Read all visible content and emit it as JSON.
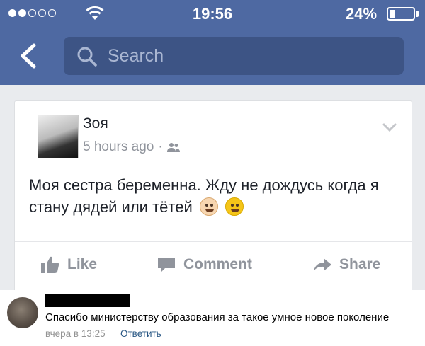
{
  "status_bar": {
    "time": "19:56",
    "battery": "24%",
    "battery_level": 0.24
  },
  "nav": {
    "search_placeholder": "Search"
  },
  "post": {
    "author": "Зоя",
    "time": "5 hours ago",
    "separator": "·",
    "text": "Моя сестра беременна. Жду не дождусь когда я стану дядей или тётей",
    "emojis": [
      "baby-emoji",
      "sweat-smile-emoji"
    ],
    "actions": {
      "like": "Like",
      "comment": "Comment",
      "share": "Share"
    }
  },
  "comment": {
    "text": "Спасибо министерству образования за такое умное новое поколение",
    "time": "вчера в 13:25",
    "reply": "Ответить"
  }
}
